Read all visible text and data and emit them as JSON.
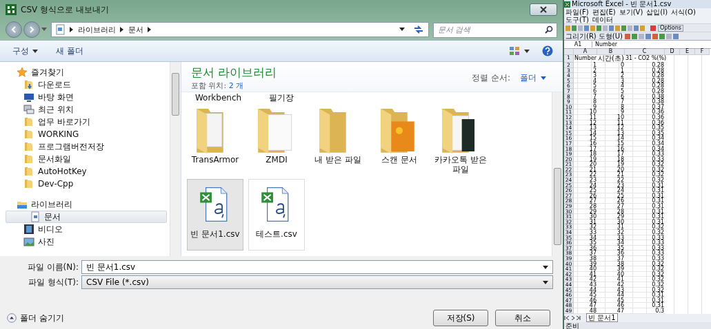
{
  "dialog": {
    "title": "CSV 형식으로 내보내기",
    "breadcrumb": [
      "라이브러리",
      "문서"
    ],
    "search": {
      "placeholder": "문서 검색"
    },
    "commands": [
      {
        "label": "구성",
        "menu": true
      },
      {
        "label": "새 폴더",
        "menu": false
      }
    ],
    "nav_groups": [
      {
        "label": "즐겨찾기",
        "kind": "favorites",
        "items": [
          {
            "label": "다운로드",
            "kind": "download",
            "selected": false
          },
          {
            "label": "바탕 화면",
            "kind": "desktop",
            "selected": false
          },
          {
            "label": "최근 위치",
            "kind": "recent",
            "selected": false
          },
          {
            "label": "업무 바로가기",
            "kind": "folder",
            "selected": false
          },
          {
            "label": "WORKING",
            "kind": "folder",
            "selected": false
          },
          {
            "label": "프로그램버전저장",
            "kind": "folder",
            "selected": false
          },
          {
            "label": "문서화일",
            "kind": "folder",
            "selected": false
          },
          {
            "label": "AutoHotKey",
            "kind": "folder",
            "selected": false
          },
          {
            "label": "Dev-Cpp",
            "kind": "folder",
            "selected": false
          }
        ]
      },
      {
        "label": "라이브러리",
        "kind": "library",
        "items": [
          {
            "label": "문서",
            "kind": "document",
            "selected": true
          },
          {
            "label": "비디오",
            "kind": "video",
            "selected": false
          },
          {
            "label": "사진",
            "kind": "picture",
            "selected": false
          }
        ]
      }
    ],
    "library": {
      "title": "문서 라이브러리",
      "includes_label": "포함 위치:",
      "includes_value": "2 개",
      "sort_label": "정렬 순서:",
      "sort_value": "폴더"
    },
    "cut_labels": [
      "Workbench",
      "필기장"
    ],
    "files": [
      {
        "name": "TransArmor",
        "kind": "folder-docs",
        "selected": false
      },
      {
        "name": "ZMDI",
        "kind": "folder-page",
        "selected": false
      },
      {
        "name": "내 받은 파일",
        "kind": "folder",
        "selected": false
      },
      {
        "name": "스캔 문서",
        "kind": "folder-photo",
        "selected": false
      },
      {
        "name": "카카오톡 받은 파일",
        "kind": "folder-media",
        "selected": false
      },
      {
        "name": "빈 문서1.csv",
        "kind": "csv",
        "selected": true
      },
      {
        "name": "테스트.csv",
        "kind": "csv",
        "selected": false
      }
    ],
    "file_name": {
      "label": "파일 이름(N):",
      "value": "빈 문서1.csv"
    },
    "file_type": {
      "label": "파일 형식(T):",
      "value": "CSV File (*.csv)"
    },
    "hide_folders": "폴더 숨기기",
    "buttons": [
      "저장(S)",
      "취소"
    ]
  },
  "excel": {
    "title": "Microsoft Excel - 빈 문서1.csv",
    "menus": [
      "파일(F)",
      "편집(E)",
      "보기(V)",
      "삽입(I)",
      "서식(O)",
      "도구(T)",
      "데이터"
    ],
    "drawing_toolbar": [
      "그리기(R)",
      "도형(U)"
    ],
    "options": "Options",
    "name_box": "A1",
    "formula": "Number",
    "columns": [
      "A",
      "B",
      "C",
      "D",
      "E",
      "F"
    ],
    "header_row": {
      "n": "1",
      "cells": [
        "Number",
        "시간(초)",
        "31 - CO2 %(%)"
      ]
    },
    "rows": [
      {
        "n": "2",
        "cells": [
          "1",
          "0",
          "0.28"
        ]
      },
      {
        "n": "3",
        "cells": [
          "2",
          "1",
          "0.28"
        ]
      },
      {
        "n": "4",
        "cells": [
          "3",
          "2",
          "0.28"
        ]
      },
      {
        "n": "5",
        "cells": [
          "4",
          "3",
          "0.28"
        ]
      },
      {
        "n": "6",
        "cells": [
          "5",
          "4",
          "0.28"
        ]
      },
      {
        "n": "7",
        "cells": [
          "6",
          "5",
          "0.28"
        ]
      },
      {
        "n": "8",
        "cells": [
          "7",
          "6",
          "0.38"
        ]
      },
      {
        "n": "9",
        "cells": [
          "8",
          "7",
          "0.38"
        ]
      },
      {
        "n": "10",
        "cells": [
          "9",
          "8",
          "0.37"
        ]
      },
      {
        "n": "11",
        "cells": [
          "10",
          "9",
          "0.36"
        ]
      },
      {
        "n": "12",
        "cells": [
          "11",
          "10",
          "0.36"
        ]
      },
      {
        "n": "13",
        "cells": [
          "12",
          "11",
          "0.36"
        ]
      },
      {
        "n": "14",
        "cells": [
          "13",
          "12",
          "0.35"
        ]
      },
      {
        "n": "15",
        "cells": [
          "14",
          "13",
          "0.35"
        ]
      },
      {
        "n": "16",
        "cells": [
          "15",
          "14",
          "0.34"
        ]
      },
      {
        "n": "17",
        "cells": [
          "16",
          "15",
          "0.34"
        ]
      },
      {
        "n": "18",
        "cells": [
          "17",
          "16",
          "0.34"
        ]
      },
      {
        "n": "19",
        "cells": [
          "18",
          "17",
          "0.33"
        ]
      },
      {
        "n": "20",
        "cells": [
          "19",
          "18",
          "0.33"
        ]
      },
      {
        "n": "21",
        "cells": [
          "20",
          "19",
          "0.32"
        ]
      },
      {
        "n": "22",
        "cells": [
          "21",
          "20",
          "0.32"
        ]
      },
      {
        "n": "23",
        "cells": [
          "22",
          "21",
          "0.32"
        ]
      },
      {
        "n": "24",
        "cells": [
          "23",
          "22",
          "0.32"
        ]
      },
      {
        "n": "25",
        "cells": [
          "24",
          "23",
          "0.31"
        ]
      },
      {
        "n": "26",
        "cells": [
          "25",
          "24",
          "0.31"
        ]
      },
      {
        "n": "27",
        "cells": [
          "26",
          "25",
          "0.31"
        ]
      },
      {
        "n": "28",
        "cells": [
          "27",
          "26",
          "0.31"
        ]
      },
      {
        "n": "29",
        "cells": [
          "28",
          "27",
          "0.31"
        ]
      },
      {
        "n": "30",
        "cells": [
          "29",
          "28",
          "0.31"
        ]
      },
      {
        "n": "31",
        "cells": [
          "30",
          "29",
          "0.31"
        ]
      },
      {
        "n": "32",
        "cells": [
          "31",
          "30",
          "0.31"
        ]
      },
      {
        "n": "33",
        "cells": [
          "32",
          "31",
          "0.32"
        ]
      },
      {
        "n": "34",
        "cells": [
          "33",
          "32",
          "0.32"
        ]
      },
      {
        "n": "35",
        "cells": [
          "34",
          "33",
          "0.33"
        ]
      },
      {
        "n": "36",
        "cells": [
          "35",
          "34",
          "0.33"
        ]
      },
      {
        "n": "37",
        "cells": [
          "36",
          "35",
          "0.33"
        ]
      },
      {
        "n": "38",
        "cells": [
          "37",
          "36",
          "0.33"
        ]
      },
      {
        "n": "39",
        "cells": [
          "38",
          "37",
          "0.33"
        ]
      },
      {
        "n": "40",
        "cells": [
          "39",
          "38",
          "0.32"
        ]
      },
      {
        "n": "41",
        "cells": [
          "40",
          "39",
          "0.32"
        ]
      },
      {
        "n": "42",
        "cells": [
          "41",
          "40",
          "0.32"
        ]
      },
      {
        "n": "43",
        "cells": [
          "42",
          "41",
          "0.32"
        ]
      },
      {
        "n": "44",
        "cells": [
          "43",
          "42",
          "0.32"
        ]
      },
      {
        "n": "45",
        "cells": [
          "44",
          "43",
          "0.32"
        ]
      },
      {
        "n": "46",
        "cells": [
          "45",
          "44",
          "0.31"
        ]
      },
      {
        "n": "47",
        "cells": [
          "46",
          "45",
          "0.31"
        ]
      },
      {
        "n": "48",
        "cells": [
          "47",
          "46",
          "0.31"
        ]
      },
      {
        "n": "49",
        "cells": [
          "48",
          "47",
          "0.3"
        ]
      }
    ],
    "sheet_tab": "빈 문서1",
    "status": "준비"
  }
}
